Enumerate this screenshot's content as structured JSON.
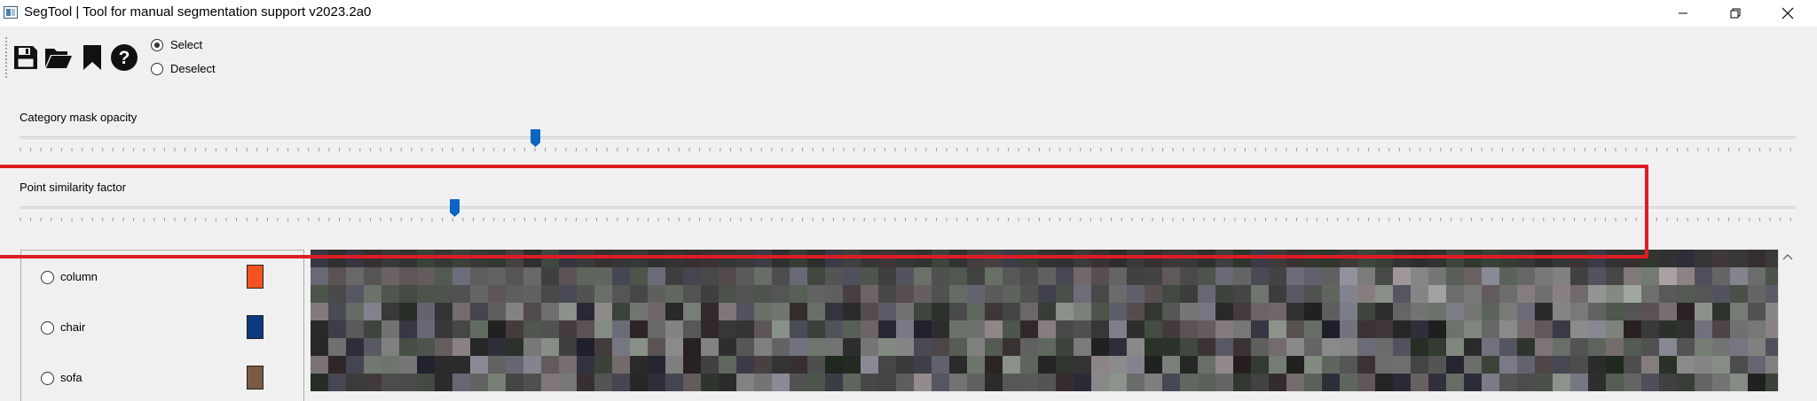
{
  "window": {
    "title": "SegTool | Tool for manual segmentation support v2023.2a0",
    "icons": [
      "app-icon",
      "minimize-icon",
      "restore-icon",
      "close-icon"
    ]
  },
  "toolbar": {
    "icons": [
      "save-icon",
      "open-folder-icon",
      "bookmark-icon",
      "help-icon"
    ],
    "mode_options": [
      {
        "label": "Select",
        "checked": true
      },
      {
        "label": "Deselect",
        "checked": false
      }
    ]
  },
  "sliders": {
    "opacity": {
      "label": "Category mask opacity",
      "value_fraction": 0.29
    },
    "similarity": {
      "label": "Point similarity factor",
      "value_fraction": 0.245
    }
  },
  "categories": [
    {
      "label": "column",
      "color": "#f45320"
    },
    {
      "label": "chair",
      "color": "#0b3a7e"
    },
    {
      "label": "sofa",
      "color": "#7a5a45"
    }
  ],
  "colors": {
    "accent": "#0a66c2",
    "highlight": "#e01c23"
  }
}
